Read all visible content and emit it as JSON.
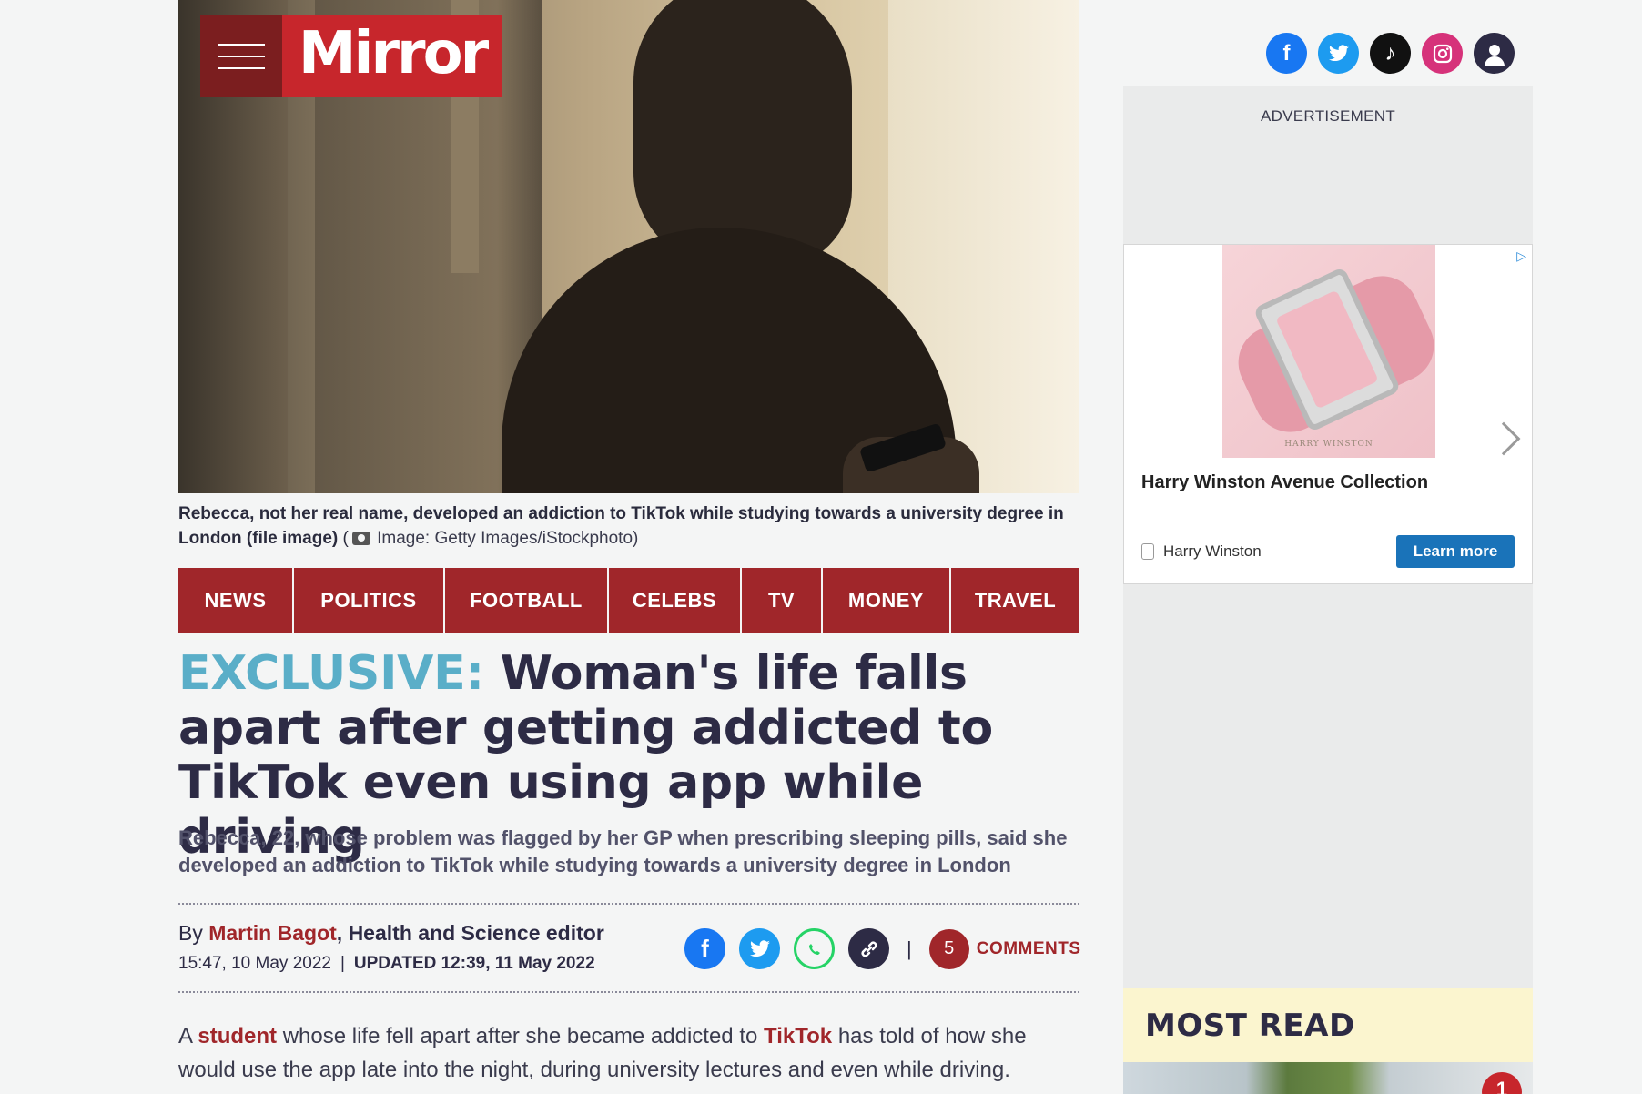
{
  "header": {
    "brand": "Mirror"
  },
  "hero": {
    "caption": "Rebecca, not her real name, developed an addiction to TikTok while studying towards a university degree in London (file image)",
    "credit_prefix": " (",
    "credit": "Image: Getty Images/iStockphoto)"
  },
  "nav": {
    "items": [
      {
        "label": "NEWS"
      },
      {
        "label": "POLITICS"
      },
      {
        "label": "FOOTBALL"
      },
      {
        "label": "CELEBS"
      },
      {
        "label": "TV"
      },
      {
        "label": "MONEY"
      },
      {
        "label": "TRAVEL"
      }
    ]
  },
  "article": {
    "exclusive": "EXCLUSIVE:",
    "headline": " Woman's life falls apart after getting addicted to TikTok even using app while driving",
    "standfirst": "Rebecca, 22, whose problem was flagged by her GP when prescribing sleeping pills, said she developed an addiction to TikTok while studying towards a university degree in London",
    "byline_prefix": "By ",
    "author": "Martin Bagot",
    "role": ", Health and Science editor",
    "published": "15:47, 10 May 2022",
    "date_sep": "|",
    "updated": "UPDATED 12:39, 11 May 2022",
    "comment_count": "5",
    "comments_label": "COMMENTS",
    "share_sep": "|",
    "body_1": "A ",
    "body_link_1": "student",
    "body_2": " whose life fell apart after she became addicted to ",
    "body_link_2": "TikTok",
    "body_3": " has told of how she would use the app late into the night, during university lectures and even while driving."
  },
  "sidebar": {
    "advertisement_label": "ADVERTISEMENT",
    "ad": {
      "watch_brand": "HARRY WINSTON",
      "title": "Harry Winston Avenue Collection",
      "advertiser": "Harry Winston",
      "cta": "Learn more"
    },
    "most_read": {
      "heading": "MOST READ",
      "first_rank": "1"
    }
  },
  "colors": {
    "brand_red": "#c7262c",
    "nav_red": "#a0262a",
    "exclusive_blue": "#5aaec8",
    "facebook": "#1877f2",
    "twitter": "#1d9bf0",
    "whatsapp": "#25d366"
  },
  "icons": {
    "social_header": [
      "facebook-icon",
      "twitter-icon",
      "tiktok-icon",
      "instagram-icon",
      "account-icon"
    ],
    "share": [
      "facebook-icon",
      "twitter-icon",
      "whatsapp-icon",
      "link-icon"
    ]
  }
}
